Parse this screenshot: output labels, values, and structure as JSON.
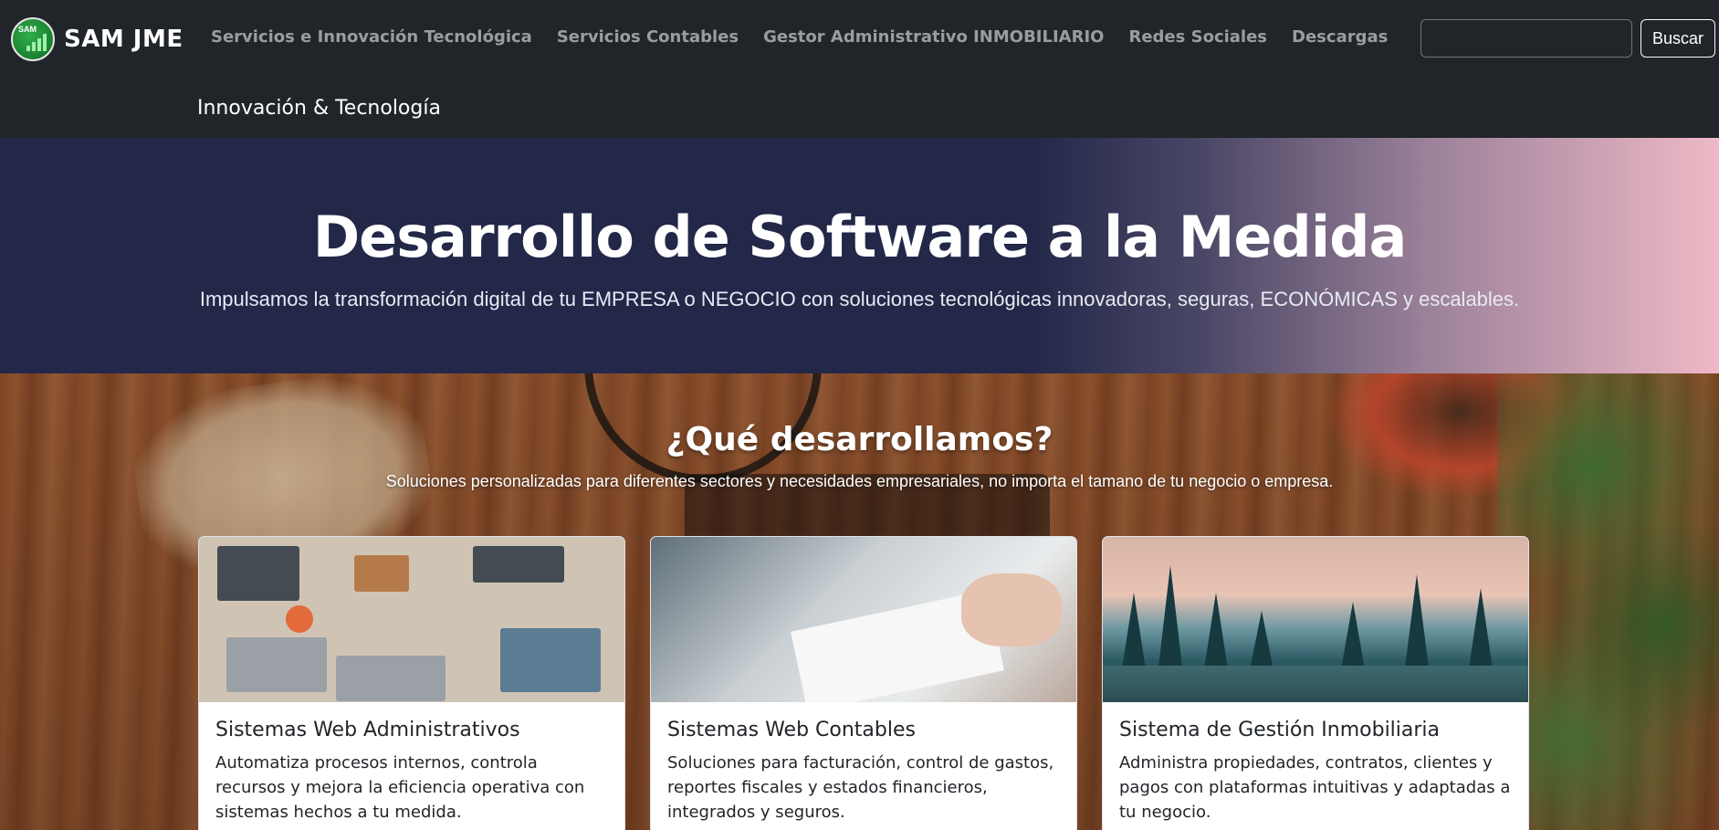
{
  "brand": {
    "name": "SAM JME",
    "logo_text": "SAM"
  },
  "nav": {
    "items": [
      "Servicios e Innovación Tecnológica",
      "Servicios Contables",
      "Gestor Administrativo INMOBILIARIO",
      "Redes Sociales",
      "Descargas"
    ],
    "search_value": "",
    "search_button": "Buscar",
    "subtitle": "Innovación & Tecnología"
  },
  "hero": {
    "title": "Desarrollo de Software a la Medida",
    "subtitle": "Impulsamos la transformación digital de tu EMPRESA o NEGOCIO con soluciones tecnológicas innovadoras, seguras, ECONÓMICAS y escalables."
  },
  "section": {
    "title": "¿Qué desarrollamos?",
    "subtitle": "Soluciones personalizadas para diferentes sectores y necesidades empresariales, no importa el tamano de tu negocio o empresa."
  },
  "cards": [
    {
      "title": "Sistemas Web Administrativos",
      "text": "Automatiza procesos internos, controla recursos y mejora la eficiencia operativa con sistemas hechos a tu medida."
    },
    {
      "title": "Sistemas Web Contables",
      "text": "Soluciones para facturación, control de gastos, reportes fiscales y estados financieros, integrados y seguros."
    },
    {
      "title": "Sistema de Gestión Inmobiliaria",
      "text": "Administra propiedades, contratos, clientes y pagos con plataformas intuitivas y adaptadas a tu negocio."
    }
  ],
  "colors": {
    "navbar": "#212529",
    "hero_start": "#232849",
    "hero_end": "#efb9c6"
  }
}
